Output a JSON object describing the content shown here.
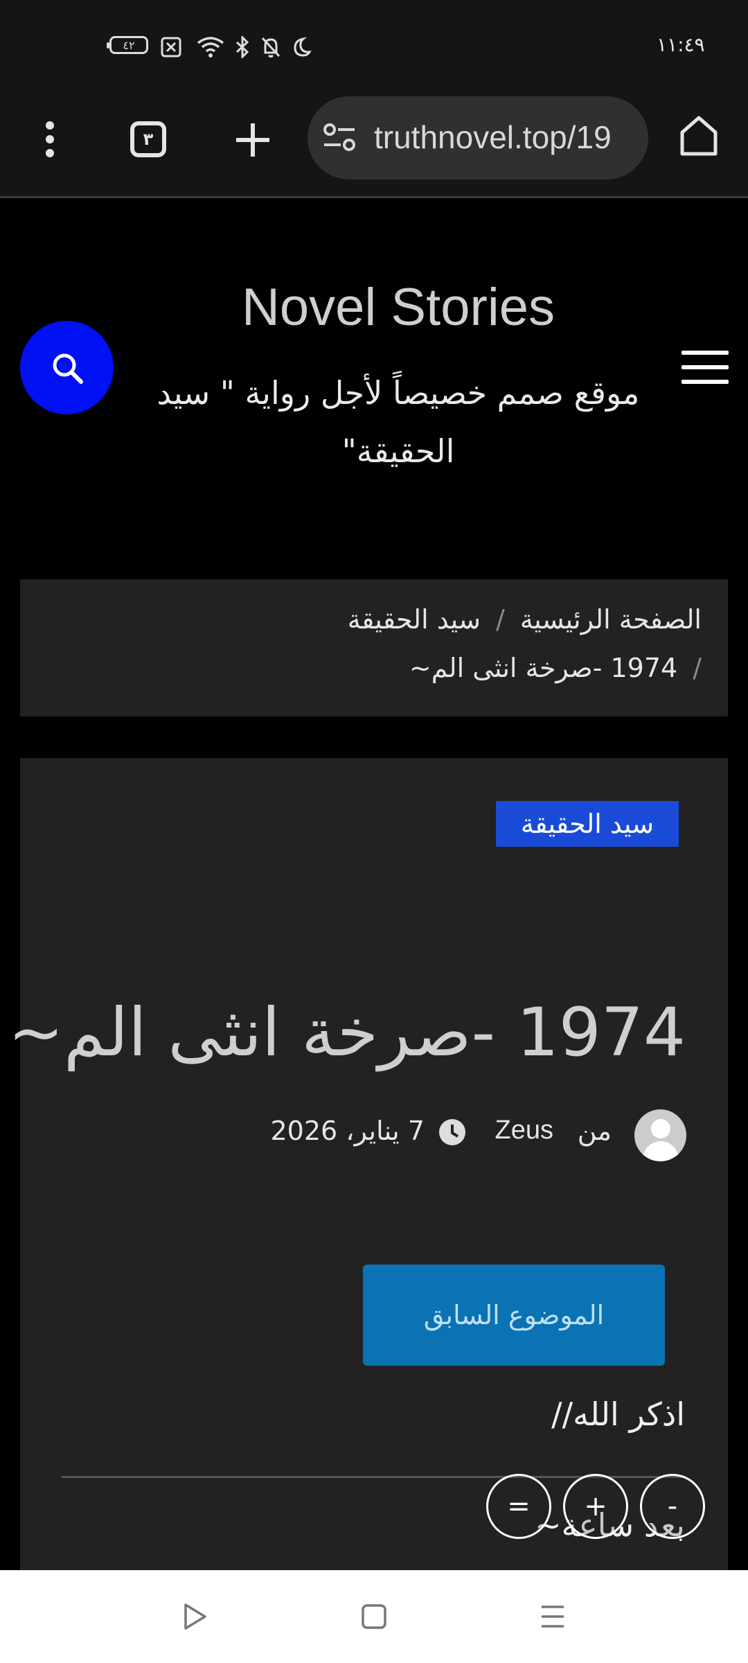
{
  "status_bar": {
    "time": "١١:٤٩",
    "battery": "٤٢"
  },
  "browser": {
    "url": "truthnovel.top/19",
    "tab_count": "٣"
  },
  "site": {
    "title": "Novel Stories",
    "description": "موقع صمم خصيصاً لأجل رواية \" سيد الحقيقة\""
  },
  "breadcrumb": {
    "home": "الصفحة الرئيسية",
    "separator": "/",
    "category": "سيد الحقيقة",
    "current": "1974 -صرخة انثى الم~"
  },
  "article": {
    "category_badge": "سيد الحقيقة",
    "title": "1974 -صرخة انثى الم~",
    "by_label": "من",
    "author": "Zeus",
    "date": "7 يناير، 2026",
    "prev_button": "الموضوع السابق",
    "dhikr": "اذكر الله//",
    "first_line": "بعد ساعة~"
  },
  "font_controls": {
    "decrease": "-",
    "increase": "+",
    "reset": "="
  },
  "colors": {
    "accent_blue": "#0011f5",
    "badge_blue": "#1a4bd8",
    "button_blue": "#0b72b3",
    "card_bg": "#222222"
  }
}
